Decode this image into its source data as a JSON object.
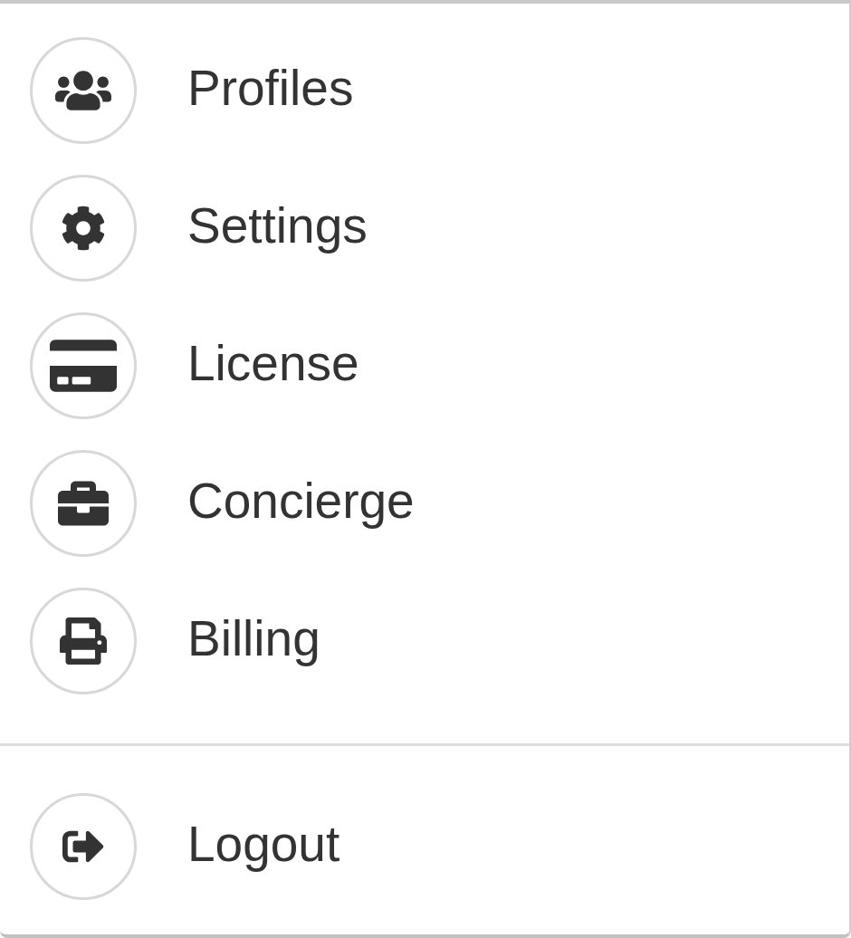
{
  "menu": {
    "items": [
      {
        "label": "Profiles"
      },
      {
        "label": "Settings"
      },
      {
        "label": "License"
      },
      {
        "label": "Concierge"
      },
      {
        "label": "Billing"
      }
    ],
    "footer_items": [
      {
        "label": "Logout"
      }
    ]
  }
}
